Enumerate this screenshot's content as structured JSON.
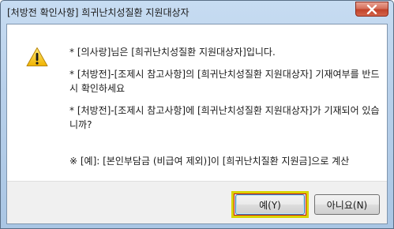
{
  "window": {
    "title": "[처방전 확인사항] 희귀난치성질환 지원대상자",
    "close_label": "close"
  },
  "dialog": {
    "icon": "warning-icon",
    "messages": [
      "* [의사랑]님은 [희귀난치성질환 지원대상자]입니다.",
      "* [처방전]-[조제시 참고사항]의 [희귀난치성질환 지원대상자] 기재여부를 반드시 확인하세요",
      "* [처방전]-[조제시 참고사항]에 [희귀난치성질환 지원대상자]가 기재되어 있습니까?",
      "※ [예]: [본인부담금 (비급여 제외)]이 [희귀난치질환 지원금]으로 계산"
    ]
  },
  "buttons": {
    "yes_label": "예(Y)",
    "no_label": "아니요(N)"
  },
  "colors": {
    "frame": "#b8d0ea",
    "close_button": "#c2432a",
    "highlight_outer": "#d9d300",
    "highlight_inner": "#c81d1d"
  }
}
